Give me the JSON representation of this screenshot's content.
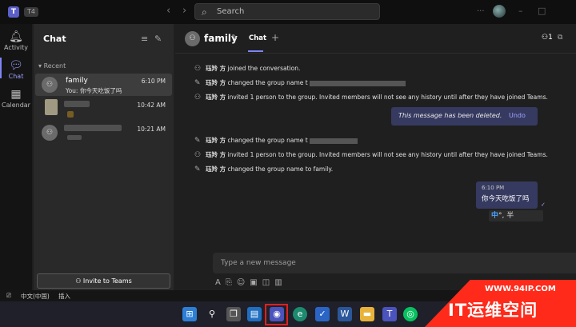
{
  "titlebar": {
    "logo": "T",
    "badge": "T4",
    "search_placeholder": "Search",
    "minimize": "–",
    "maximize": "□"
  },
  "rail": {
    "items": [
      {
        "label": "Activity",
        "icon": "bell-icon"
      },
      {
        "label": "Chat",
        "icon": "chat-icon"
      },
      {
        "label": "Calendar",
        "icon": "calendar-icon"
      }
    ],
    "accent_color": "#7f85f5"
  },
  "chatlist": {
    "title": "Chat",
    "section": "Recent",
    "chats": [
      {
        "name": "family",
        "preview": "You: 你今天吃饭了吗",
        "time": "6:10 PM",
        "selected": true
      },
      {
        "name": "",
        "preview": "",
        "time": "10:42 AM",
        "selected": false
      },
      {
        "name": "",
        "preview": "",
        "time": "10:21 AM",
        "selected": false
      }
    ],
    "invite_button": "Invite to Teams"
  },
  "conversation": {
    "group_name": "family",
    "tab": "Chat",
    "participants_count": "1",
    "events": [
      {
        "icon": "person-add-icon",
        "who": "珏羚 方",
        "text": " joined the conversation."
      },
      {
        "icon": "pencil-icon",
        "who": "珏羚 方",
        "text": " changed the group name t"
      },
      {
        "icon": "person-add-icon",
        "who": "珏羚 方",
        "text": " invited 1 person to the group. Invited members will not see any history until after they have joined Teams."
      }
    ],
    "deleted_message": "This message has been deleted.",
    "undo_label": "Undo",
    "events2": [
      {
        "icon": "pencil-icon",
        "who": "珏羚 方",
        "text": " changed the group name t"
      },
      {
        "icon": "person-add-icon",
        "who": "珏羚 方",
        "text": " invited 1 person to the group. Invited members will not see any history until after they have joined Teams."
      },
      {
        "icon": "pencil-icon",
        "who": "珏羚 方",
        "text": " changed the group name to family."
      }
    ],
    "my_message": {
      "time": "6:10 PM",
      "text": "你今天吃饭了吗"
    },
    "ime_indicator": {
      "mode": "中",
      "rest": "°, 半"
    },
    "compose_placeholder": "Type a new message"
  },
  "system_bar": {
    "lang": "中文(中国)",
    "mode": "插入"
  },
  "watermark": {
    "url": "WWW.94IP.COM",
    "text": "IT运维空间"
  }
}
